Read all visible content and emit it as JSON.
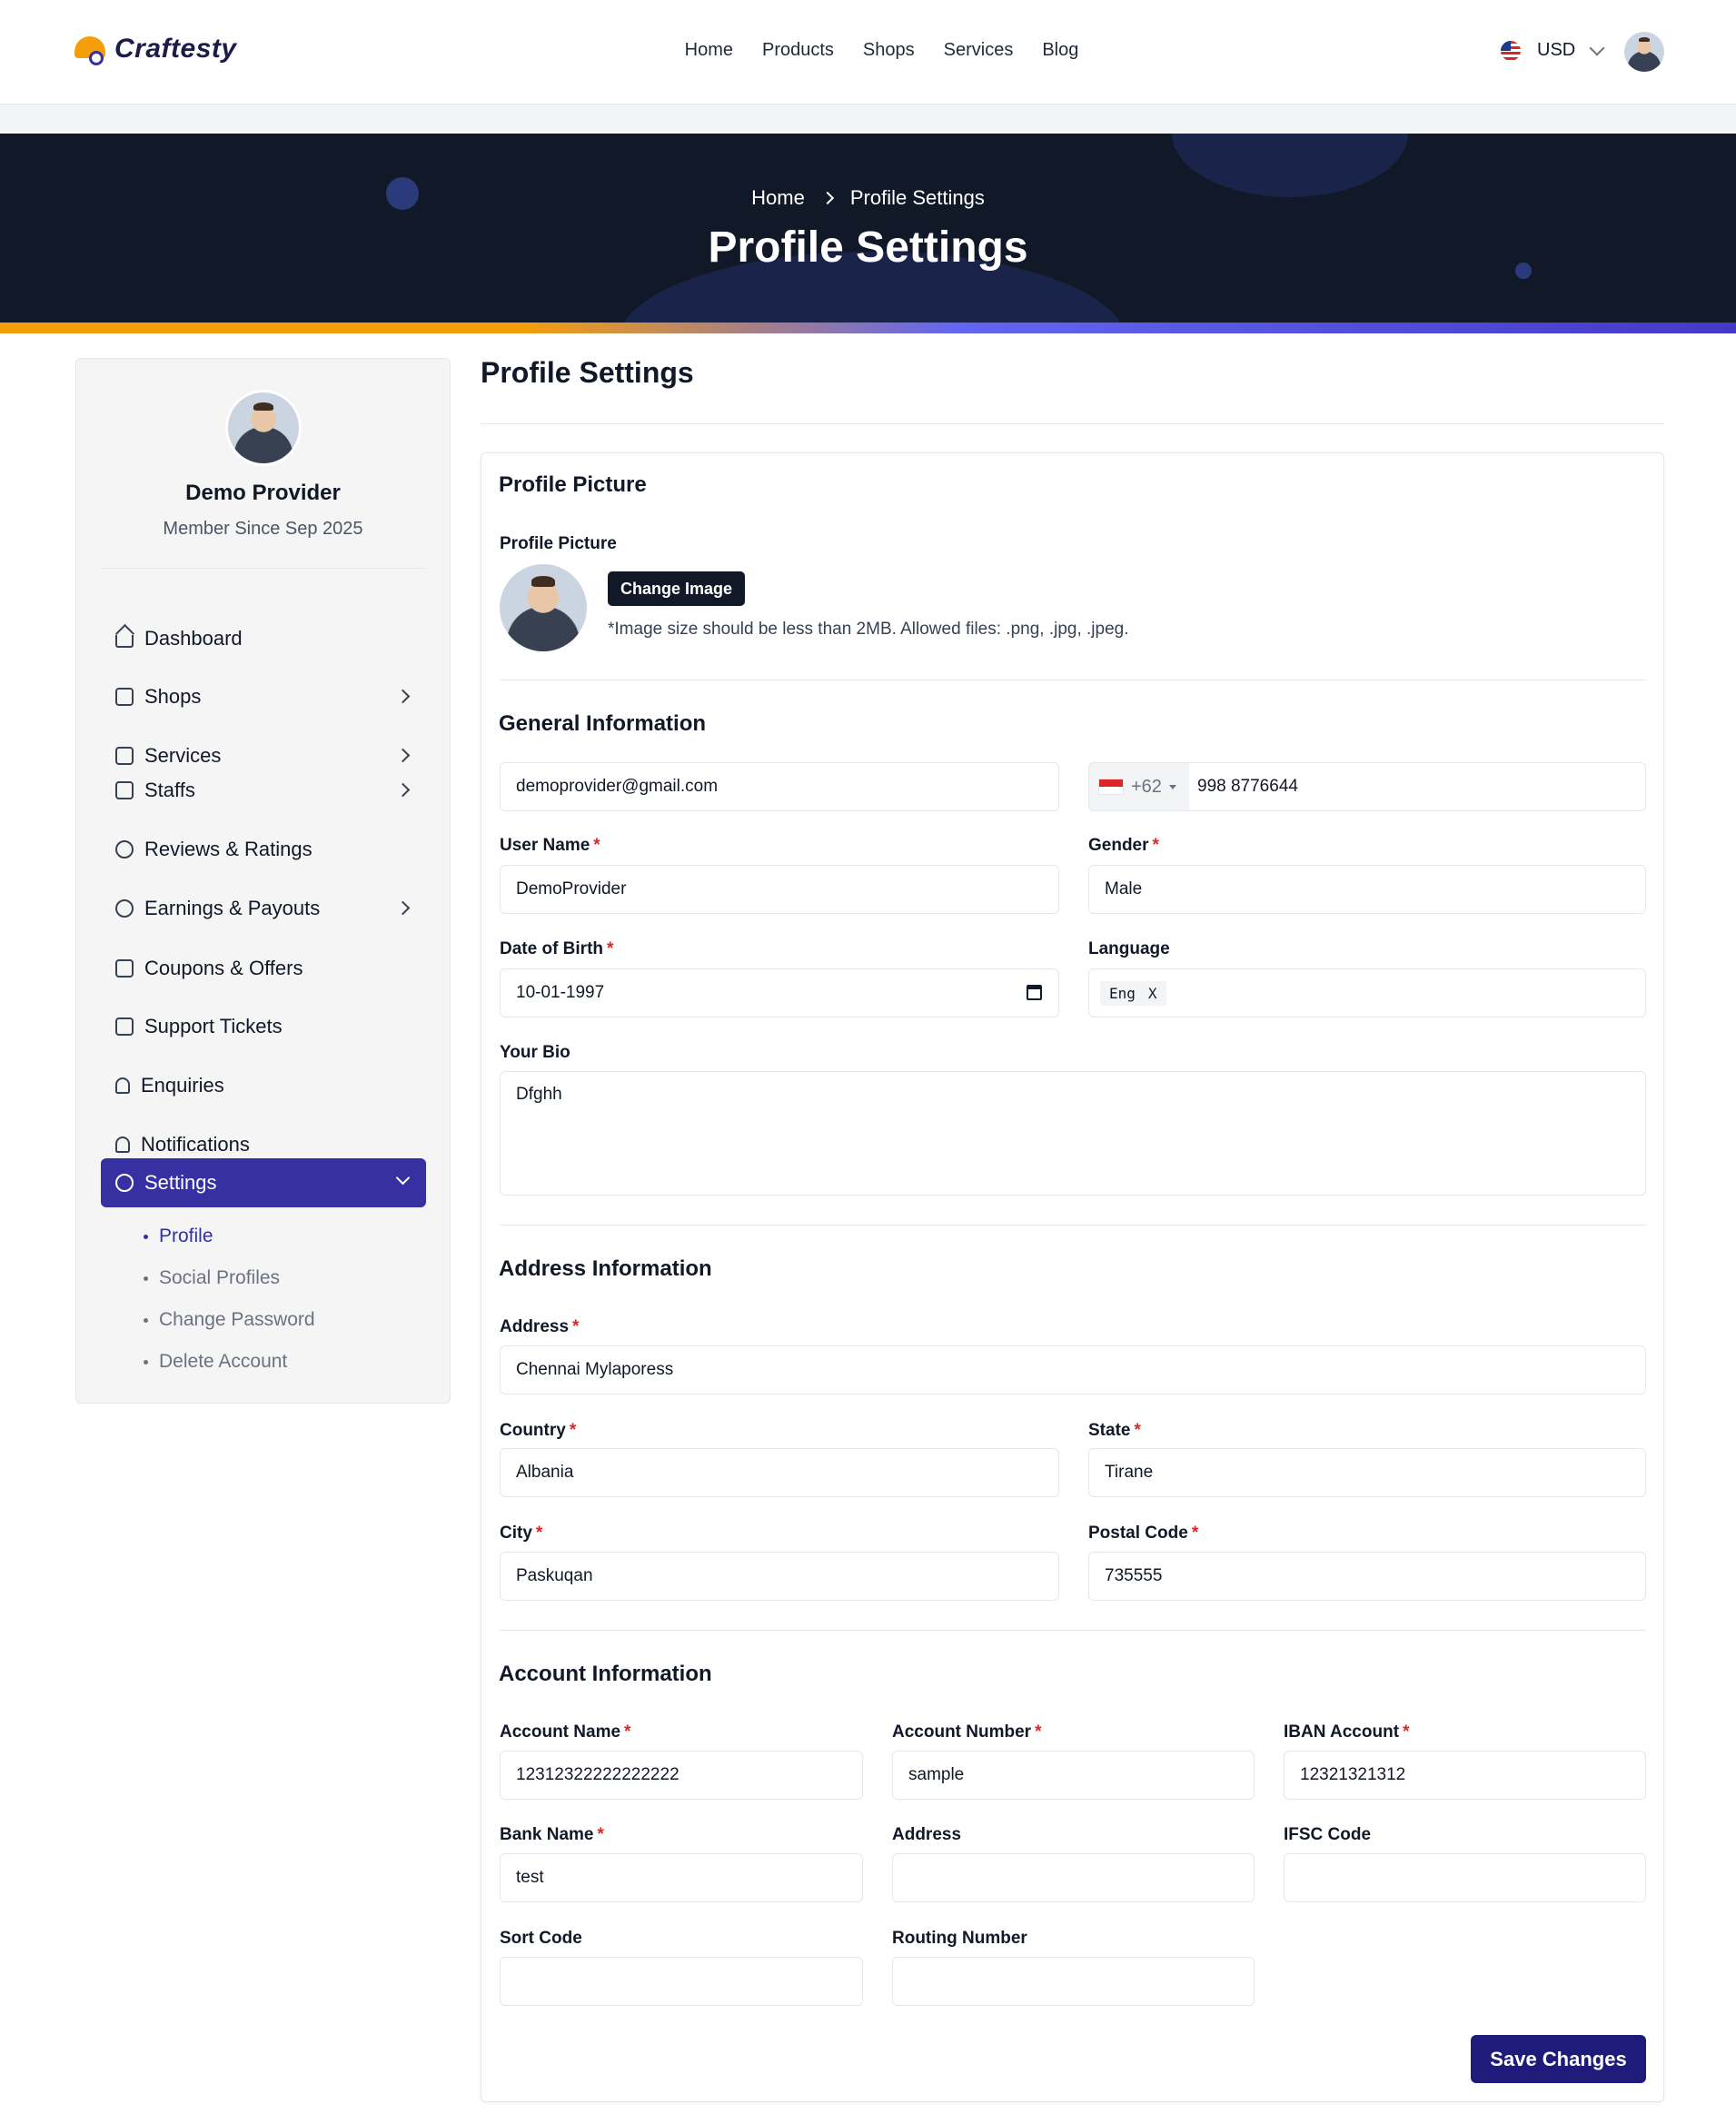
{
  "brand": {
    "name": "Craftesty"
  },
  "nav": {
    "items": [
      "Home",
      "Products",
      "Shops",
      "Services",
      "Blog"
    ]
  },
  "header": {
    "currency": "USD"
  },
  "hero": {
    "breadcrumb_home": "Home",
    "breadcrumb_current": "Profile Settings",
    "title": "Profile Settings"
  },
  "sidebar": {
    "name": "Demo Provider",
    "member_since": "Member Since Sep 2025",
    "items": [
      {
        "label": "Dashboard"
      },
      {
        "label": "Shops"
      },
      {
        "label": "Services"
      },
      {
        "label": "Staffs"
      },
      {
        "label": "Reviews & Ratings"
      },
      {
        "label": "Earnings & Payouts"
      },
      {
        "label": "Coupons & Offers"
      },
      {
        "label": "Support Tickets"
      },
      {
        "label": "Enquiries"
      },
      {
        "label": "Notifications"
      },
      {
        "label": "Settings"
      }
    ],
    "settings_sub": [
      "Profile",
      "Social Profiles",
      "Change Password",
      "Delete Account"
    ]
  },
  "main": {
    "title": "Profile Settings"
  },
  "profile_picture": {
    "section_title": "Profile Picture",
    "label": "Profile Picture",
    "button": "Change Image",
    "hint": "*Image size should be less than 2MB. Allowed files: .png, .jpg, .jpeg."
  },
  "general": {
    "section_title": "General Information",
    "email": "demoprovider@gmail.com",
    "phone_code": "+62",
    "phone": "998 8776644",
    "username_label": "User Name",
    "username": "DemoProvider",
    "gender_label": "Gender",
    "gender": "Male",
    "dob_label": "Date of Birth",
    "dob": "10-01-1997",
    "language_label": "Language",
    "language_tag": "Eng",
    "language_remove": "X",
    "bio_label": "Your Bio",
    "bio": "Dfghh"
  },
  "address": {
    "section_title": "Address Information",
    "address_label": "Address",
    "address": "Chennai Mylaporess",
    "country_label": "Country",
    "country": "Albania",
    "state_label": "State",
    "state": "Tirane",
    "city_label": "City",
    "city": "Paskuqan",
    "postal_label": "Postal Code",
    "postal": "735555"
  },
  "account": {
    "section_title": "Account Information",
    "account_name_label": "Account Name",
    "account_name": "12312322222222222",
    "account_number_label": "Account Number",
    "account_number": "sample",
    "iban_label": "IBAN Account",
    "iban": "12321321312",
    "bank_name_label": "Bank Name",
    "bank_name": "test",
    "address_label": "Address",
    "address": "",
    "ifsc_label": "IFSC Code",
    "ifsc": "",
    "sort_code_label": "Sort Code",
    "sort_code": "",
    "routing_label": "Routing Number",
    "routing": ""
  },
  "actions": {
    "save": "Save Changes"
  },
  "colors": {
    "primary": "#3730a3",
    "accent": "#f59e0b",
    "dark": "#111827",
    "required": "#dc2626"
  }
}
